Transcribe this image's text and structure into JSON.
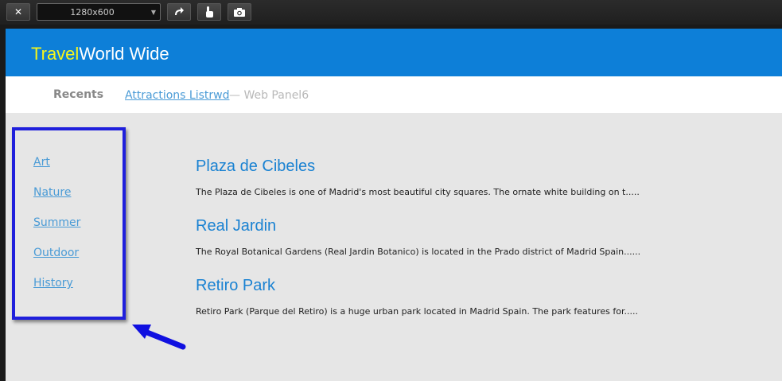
{
  "toolbar": {
    "close_icon": "close-icon",
    "resolution": "1280x600",
    "rotate_icon": "rotate-icon",
    "touch_icon": "touch-icon",
    "screenshot_icon": "camera-icon"
  },
  "header": {
    "brand_travel": "Travel",
    "brand_rest": "World Wide",
    "background": "#0d7fd8"
  },
  "breadcrumb": {
    "recents": "Recents",
    "link": "Attractions Listrwd",
    "separator": "— Web Panel6"
  },
  "sidebar": {
    "items": [
      {
        "label": "Art"
      },
      {
        "label": "Nature"
      },
      {
        "label": "Summer"
      },
      {
        "label": "Outdoor"
      },
      {
        "label": "History"
      }
    ],
    "highlight_color": "#1f1fdc"
  },
  "attractions": [
    {
      "title": "Plaza de Cibeles",
      "description": "The Plaza de Cibeles is one of Madrid's most beautiful city squares. The ornate white building on t....."
    },
    {
      "title": "Real Jardin",
      "description": "The Royal Botanical Gardens (Real Jardin Botanico) is located in the Prado district of Madrid Spain......"
    },
    {
      "title": "Retiro Park",
      "description": "Retiro Park (Parque del Retiro) is a huge urban park located in Madrid Spain. The park features for....."
    }
  ]
}
